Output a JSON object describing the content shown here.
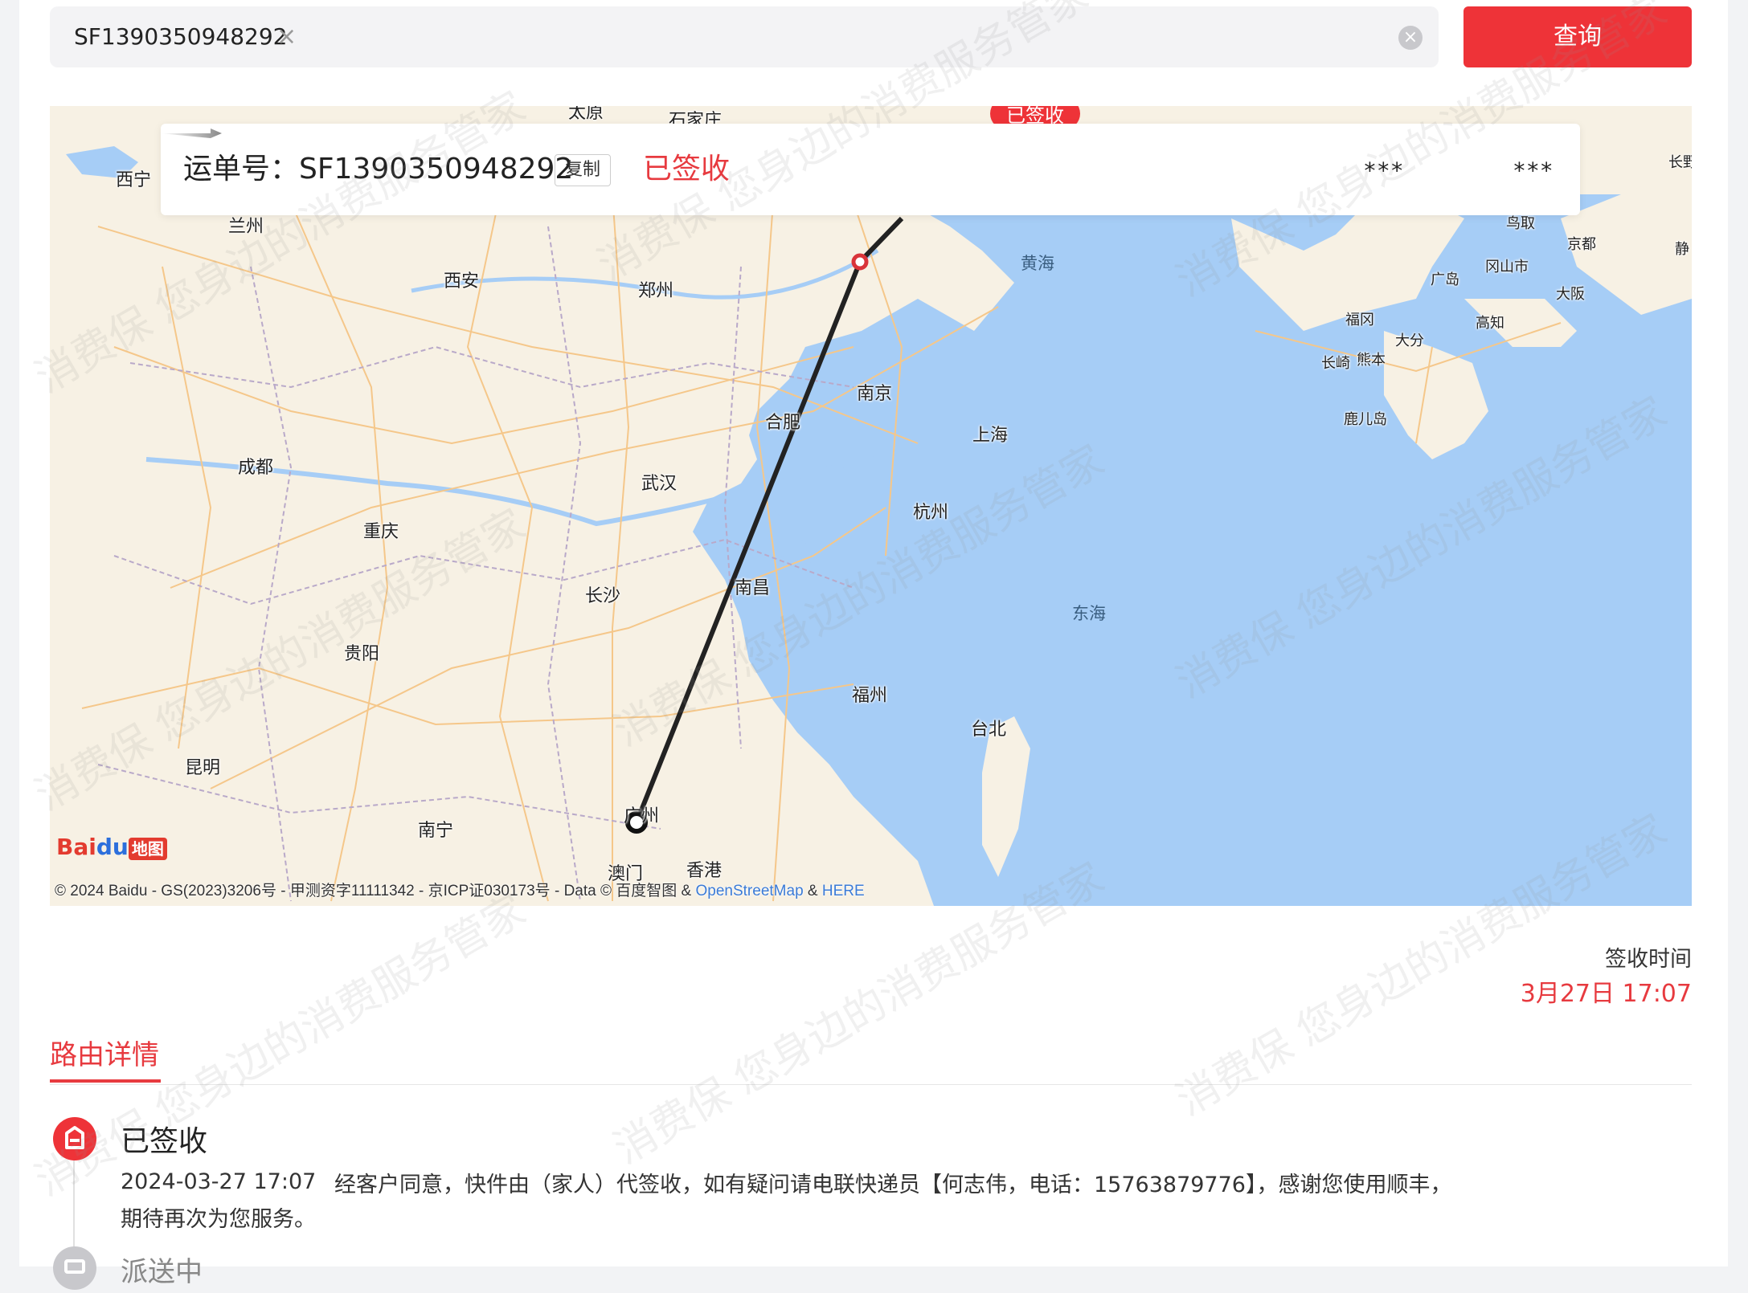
{
  "search": {
    "tag_value": "SF1390350948292",
    "tag_remove": "×",
    "clear": "×",
    "query_label": "查询"
  },
  "map": {
    "badge": "已签收",
    "card": {
      "waybill_label": "运单号：SF1390350948292",
      "copy_label": "复制",
      "status": "已签收",
      "from": "***",
      "to": "***"
    },
    "cities": {
      "taiyuan": "太原",
      "shijiazhuang": "石家庄",
      "xining": "西宁",
      "lanzhou": "兰州",
      "xian": "西安",
      "zhengzhou": "郑州",
      "nanjing": "南京",
      "hefei": "合肥",
      "shanghai": "上海",
      "chengdu": "成都",
      "wuhan": "武汉",
      "hangzhou": "杭州",
      "chongqing": "重庆",
      "changsha": "长沙",
      "nanchang": "南昌",
      "guiyang": "贵阳",
      "fuzhou": "福州",
      "taibei": "台北",
      "kunming": "昆明",
      "nanning": "南宁",
      "guangzhou": "广州",
      "aomen": "澳门",
      "xianggang": "香港",
      "tottori": "鸟取",
      "kyoto": "京都",
      "hiroshima": "广岛",
      "okayama": "冈山市",
      "osaka": "大阪",
      "fukuoka": "福冈",
      "oita": "大分",
      "kochi": "高知",
      "nagasaki": "长崎",
      "kumamoto": "熊本",
      "kagoshima": "鹿儿岛",
      "nagano": "长野",
      "shizuoka": "静"
    },
    "seas": {
      "yellow_sea": "黄海",
      "east_sea": "东海"
    },
    "logo": {
      "part1": "Bai",
      "part2": "du",
      "part3": "地图"
    },
    "copyright": {
      "main": "© 2024 Baidu - GS(2023)3206号 - 甲测资字11111342 - 京ICP证030173号 - Data © 百度智图 & ",
      "osm": "OpenStreetMap",
      "amp": " & ",
      "here": "HERE"
    }
  },
  "sign": {
    "label": "签收时间",
    "time": "3月27日 17:07"
  },
  "route": {
    "title": "路由详情",
    "events": [
      {
        "title": "已签收",
        "time": "2024-03-27 17:07",
        "desc": "经客户同意，快件由（家人）代签收，如有疑问请电联快递员【何志伟，电话：15763879776】，感谢您使用顺丰，",
        "desc2": "期待再次为您服务。"
      },
      {
        "title": "派送中"
      }
    ]
  },
  "watermark": "消费保 您身边的消费服务管家",
  "colors": {
    "accent": "#ee3338",
    "sea": "#a6cdf6",
    "land": "#f7f1e4"
  }
}
